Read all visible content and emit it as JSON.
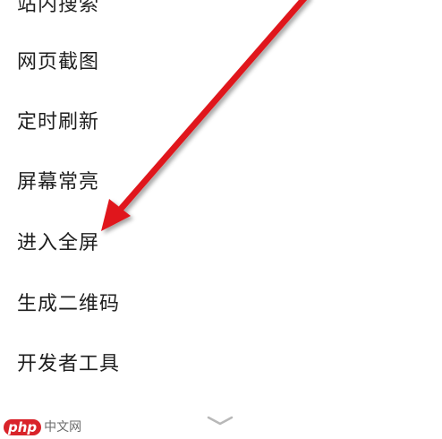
{
  "menu": {
    "items": [
      {
        "label": "站内搜索"
      },
      {
        "label": "网页截图"
      },
      {
        "label": "定时刷新"
      },
      {
        "label": "屏幕常亮"
      },
      {
        "label": "进入全屏"
      },
      {
        "label": "生成二维码"
      },
      {
        "label": "开发者工具"
      }
    ]
  },
  "overlay": {
    "arrow_color": "#e0161b",
    "arrow_icon": "red-arrow-annotation"
  },
  "footer": {
    "expand_icon": "chevron-down-icon"
  },
  "watermark": {
    "logo_text": "php",
    "site_text": "中文网"
  }
}
